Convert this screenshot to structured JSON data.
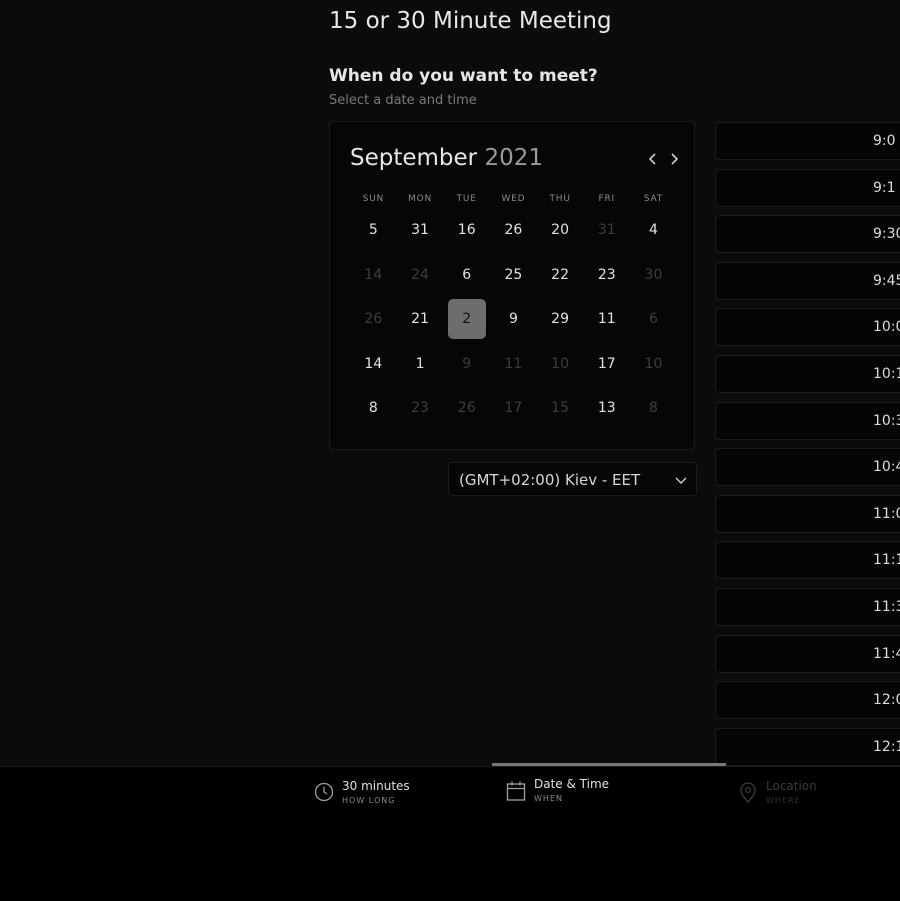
{
  "page": {
    "title": "15 or 30 Minute Meeting",
    "question": "When do you want to meet?",
    "subtitle": "Select a date and time"
  },
  "calendar": {
    "month": "September",
    "year": "2021",
    "weekdays": [
      "SUN",
      "MON",
      "TUE",
      "WED",
      "THU",
      "FRI",
      "SAT"
    ],
    "rows": [
      [
        {
          "d": "5"
        },
        {
          "d": "31"
        },
        {
          "d": "16"
        },
        {
          "d": "26"
        },
        {
          "d": "20"
        },
        {
          "d": "31",
          "muted": true
        },
        {
          "d": "4"
        }
      ],
      [
        {
          "d": "14",
          "muted": true
        },
        {
          "d": "24",
          "muted": true
        },
        {
          "d": "6"
        },
        {
          "d": "25"
        },
        {
          "d": "22"
        },
        {
          "d": "23"
        },
        {
          "d": "30",
          "muted": true
        }
      ],
      [
        {
          "d": "26",
          "muted": true
        },
        {
          "d": "21"
        },
        {
          "d": "2",
          "selected": true
        },
        {
          "d": "9"
        },
        {
          "d": "29"
        },
        {
          "d": "11"
        },
        {
          "d": "6",
          "muted": true
        }
      ],
      [
        {
          "d": "14"
        },
        {
          "d": "1"
        },
        {
          "d": "9",
          "muted": true
        },
        {
          "d": "11",
          "muted": true
        },
        {
          "d": "10",
          "muted": true
        },
        {
          "d": "17"
        },
        {
          "d": "10",
          "muted": true
        }
      ],
      [
        {
          "d": "8"
        },
        {
          "d": "23",
          "muted": true
        },
        {
          "d": "26",
          "muted": true
        },
        {
          "d": "17",
          "muted": true
        },
        {
          "d": "15",
          "muted": true
        },
        {
          "d": "13"
        },
        {
          "d": "8",
          "muted": true
        }
      ]
    ],
    "prev_icon": "chevron-left-icon",
    "next_icon": "chevron-right-icon"
  },
  "timezone": {
    "value": "(GMT+02:00) Kiev - EET",
    "icon": "chevron-down-icon"
  },
  "time_slots": [
    "9:0",
    "9:1",
    "9:30",
    "9:45",
    "10:0",
    "10:1",
    "10:3",
    "10:4",
    "11:0",
    "11:1",
    "11:3",
    "11:4",
    "12:0",
    "12:1"
  ],
  "steps": [
    {
      "label": "30 minutes",
      "sub": "HOW LONG",
      "icon": "clock-icon",
      "state": "done"
    },
    {
      "label": "Date & Time",
      "sub": "WHEN",
      "icon": "calendar-icon",
      "state": "active"
    },
    {
      "label": "Location",
      "sub": "WHERE",
      "icon": "location-pin-icon",
      "state": "disabled"
    }
  ],
  "colors": {
    "background": "#0b0b0b",
    "selected_day": "#6d6d6d",
    "progress": "#777777"
  }
}
